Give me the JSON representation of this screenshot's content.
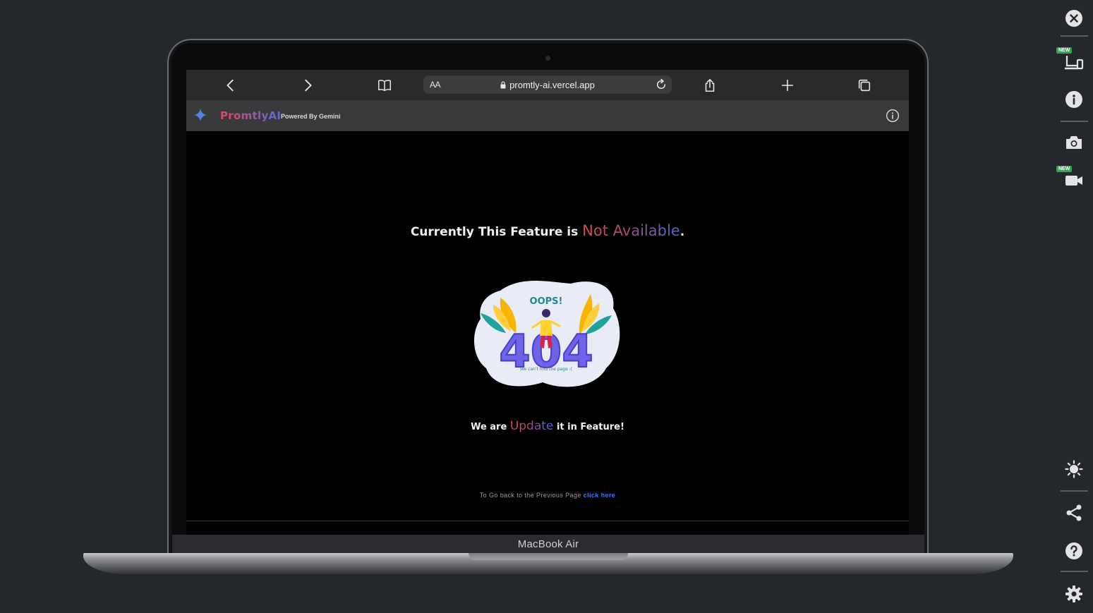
{
  "device": {
    "model_label": "MacBook Air"
  },
  "browser": {
    "text_size_label": "AA",
    "url": "promtly-ai.vercel.app"
  },
  "app_header": {
    "brand": "PromtlyAI",
    "powered_by": "Powered By Gemini"
  },
  "page": {
    "headline_prefix": "Currently This Feature is ",
    "headline_highlight": "Not Available",
    "headline_suffix": ".",
    "illustration_title": "OOPS!",
    "illustration_code": "404",
    "illustration_caption": "We can't find the page :(",
    "subline_prefix": "We are ",
    "subline_highlight": "Update",
    "subline_suffix": " it in Feature!",
    "back_text": "To Go back to the Previous Page ",
    "back_link": "click here"
  },
  "side_panel": {
    "badges": [
      "NEW",
      "NEW"
    ]
  },
  "colors": {
    "background": "#24272c",
    "gradient_start": "#e2454f",
    "gradient_end": "#4e66d8",
    "link": "#3f74ff"
  }
}
